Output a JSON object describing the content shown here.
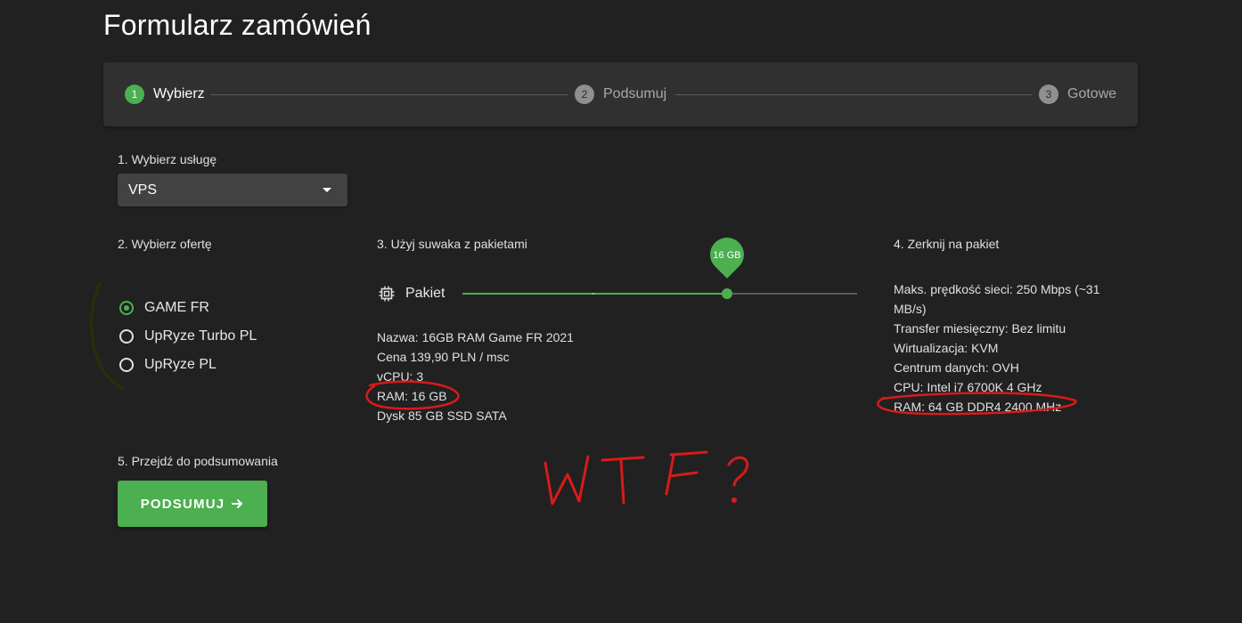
{
  "page": {
    "title": "Formularz zamówień"
  },
  "stepper": {
    "steps": [
      {
        "number": "1",
        "label": "Wybierz"
      },
      {
        "number": "2",
        "label": "Podsumuj"
      },
      {
        "number": "3",
        "label": "Gotowe"
      }
    ],
    "active_step": 1
  },
  "service": {
    "label": "1. Wybierz usługę",
    "selected": "VPS"
  },
  "offer": {
    "label": "2. Wybierz ofertę",
    "options": [
      "GAME FR",
      "UpRyze Turbo PL",
      "UpRyze PL"
    ],
    "selected": "GAME FR"
  },
  "package_slider": {
    "label": "3. Użyj suwaka z pakietami",
    "slider_label": "Pakiet",
    "value_label": "16 GB",
    "value_fraction": 0.67,
    "details": {
      "name": "Nazwa: 16GB RAM Game FR 2021",
      "price": "Cena 139,90 PLN / msc",
      "vcpu": "vCPU: 3",
      "ram": "RAM: 16 GB",
      "disk": "Dysk 85 GB SSD SATA"
    }
  },
  "package_specs": {
    "label": "4. Zerknij na pakiet",
    "speed": "Maks. prędkość sieci: 250 Mbps (~31 MB/s)",
    "transfer": "Transfer miesięczny: Bez limitu",
    "virtualization": "Wirtualizacja: KVM",
    "datacenter": "Centrum danych: OVH",
    "cpu": "CPU: Intel i7 6700K 4 GHz",
    "ram": "RAM: 64 GB DDR4 2400 MHz"
  },
  "summary": {
    "label": "5. Przejdź do podsumowania",
    "button_label": "PODSUMUJ"
  },
  "annotation": {
    "text": "WTF?",
    "color": "#d81b1b"
  },
  "colors": {
    "accent": "#4caf50",
    "background": "#212121",
    "panel": "#303030"
  }
}
